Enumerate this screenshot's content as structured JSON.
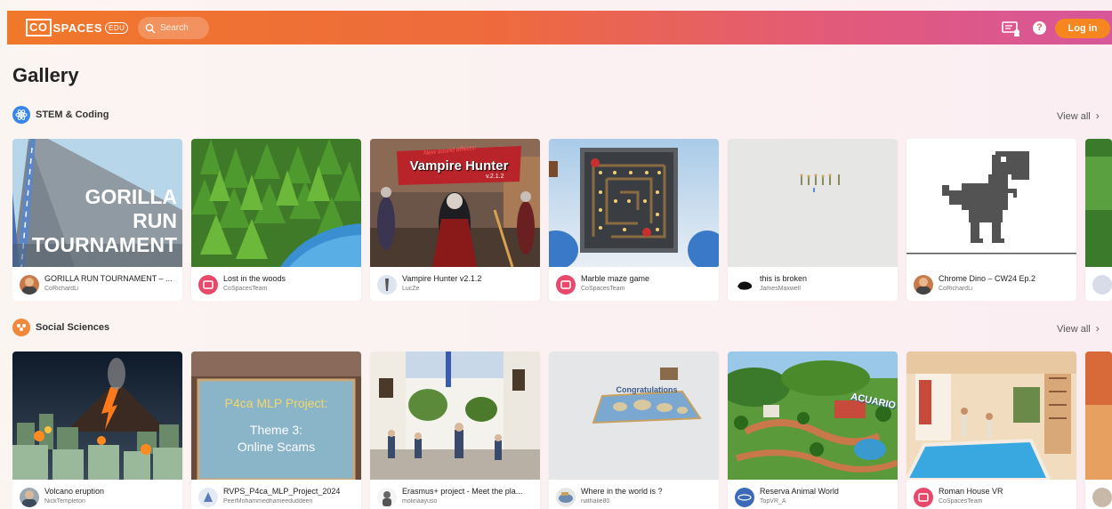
{
  "header": {
    "logo_main": "CO",
    "logo_text": "SPACES",
    "logo_badge": "EDU",
    "search_placeholder": "Search",
    "help_glyph": "?",
    "login_label": "Log in",
    "icons": [
      "search-icon",
      "classroom-icon",
      "help-icon"
    ],
    "colors": {
      "bar_start": "#f0782a",
      "bar_end": "#d8569a",
      "login_bg": "#f6861f"
    }
  },
  "gallery": {
    "title": "Gallery"
  },
  "sections": [
    {
      "label": "STEM & Coding",
      "icon": "atom-icon",
      "view_all": "View all",
      "cards": [
        {
          "title": "GORILLA RUN TOURNAMENT – ...",
          "author": "CoRichardLi",
          "thumb_text": [
            "GORILLA",
            "RUN",
            "TOURNAMENT"
          ]
        },
        {
          "title": "Lost in the woods",
          "author": "CoSpacesTeam"
        },
        {
          "title": "Vampire Hunter v2.1.2",
          "author": "LucZe",
          "thumb_text": [
            "Vampire Hunter",
            "v.2.1.2",
            "New sound effects!"
          ]
        },
        {
          "title": "Marble maze game",
          "author": "CoSpacesTeam"
        },
        {
          "title": "this is broken",
          "author": "JamesMaxwell"
        },
        {
          "title": "Chrome Dino – CW24 Ep.2",
          "author": "CoRichardLi"
        }
      ]
    },
    {
      "label": "Social Sciences",
      "icon": "globe-people-icon",
      "view_all": "View all",
      "cards": [
        {
          "title": "Volcano eruption",
          "author": "NickTempleton"
        },
        {
          "title": "RVPS_P4ca_MLP_Project_2024",
          "author": "PeerMohammedhameeduddeen",
          "thumb_text": [
            "P4ca MLP Project:",
            "Theme 3:",
            "Online Scams"
          ]
        },
        {
          "title": "Erasmus+ project - Meet the pla...",
          "author": "molinaayuso"
        },
        {
          "title": "Where in the world is ?",
          "author": "nathalie80",
          "thumb_text": [
            "Congratulations"
          ]
        },
        {
          "title": "Reserva Animal World",
          "author": "TopVR_A",
          "thumb_text": [
            "ACUARIO"
          ]
        },
        {
          "title": "Roman House VR",
          "author": "CoSpacesTeam"
        }
      ]
    }
  ]
}
